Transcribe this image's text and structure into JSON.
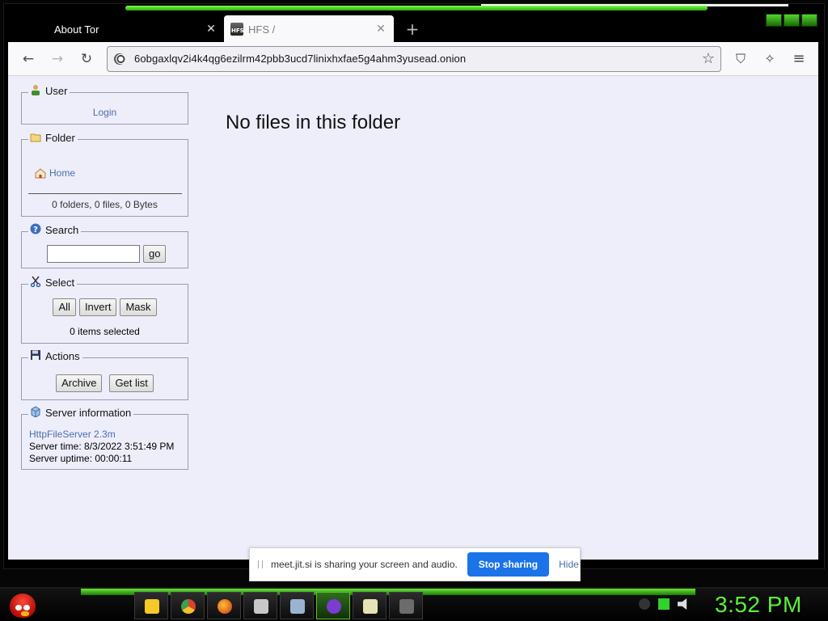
{
  "browser": {
    "tabs": [
      {
        "title": "About Tor",
        "close": "✕"
      },
      {
        "title": "HFS /",
        "close": "✕",
        "favicon_label": "HFS"
      }
    ],
    "new_tab": "+",
    "url": "6obgaxlqv2i4k4qg6ezilrm42pbb3ucd7linixhxfae5g4ahm3yusead.onion",
    "icons": {
      "back": "←",
      "forward": "→",
      "reload": "↻",
      "star": "☆",
      "shield": "⛉",
      "magic": "✧",
      "menu": "≡"
    }
  },
  "sidebar": {
    "user": {
      "legend": "User",
      "login": "Login"
    },
    "folder": {
      "legend": "Folder",
      "home": "Home",
      "stats": "0 folders, 0 files, 0 Bytes"
    },
    "search": {
      "legend": "Search",
      "input_value": "",
      "go": "go"
    },
    "select": {
      "legend": "Select",
      "all": "All",
      "invert": "Invert",
      "mask": "Mask",
      "status": "0 items selected"
    },
    "actions": {
      "legend": "Actions",
      "archive": "Archive",
      "get_list": "Get list"
    },
    "server": {
      "legend": "Server information",
      "link": "HttpFileServer 2.3m",
      "time": "Server time: 8/3/2022 3:51:49 PM",
      "uptime": "Server uptime: 00:00:11"
    }
  },
  "main": {
    "message": "No files in this folder"
  },
  "share_banner": {
    "text": "meet.jit.si is sharing your screen and audio.",
    "stop": "Stop sharing",
    "hide": "Hide"
  },
  "taskbar": {
    "clock": "3:52 PM",
    "apps": [
      {
        "name": "file-explorer",
        "color": "#f6c928"
      },
      {
        "name": "chrome",
        "color": "#d9432d"
      },
      {
        "name": "firefox",
        "color": "#e66a1a"
      },
      {
        "name": "tool-app",
        "color": "#c8c8c8"
      },
      {
        "name": "remote-desktop",
        "color": "#9ab4d0"
      },
      {
        "name": "tor-browser",
        "color": "#7c3bd3"
      },
      {
        "name": "notepad",
        "color": "#e6e2b5"
      },
      {
        "name": "hfs",
        "color": "#6c6c6c"
      }
    ],
    "accent": "#5bf03a"
  }
}
